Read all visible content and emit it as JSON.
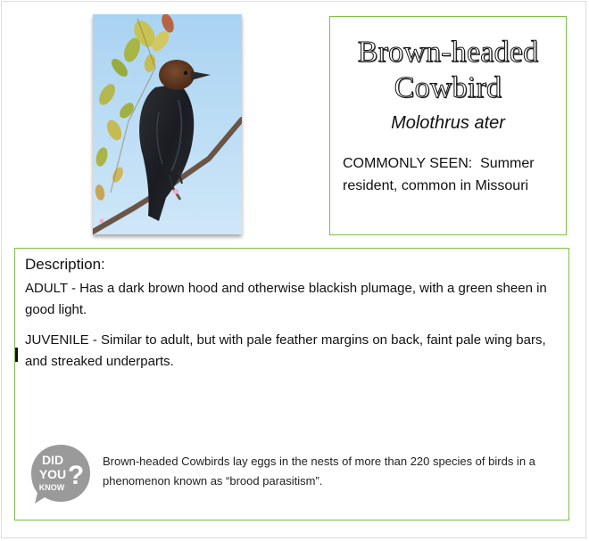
{
  "bird": {
    "common_name_line1": "Brown-headed",
    "common_name_line2": "Cowbird",
    "scientific_name": "Molothrus ater",
    "commonly_seen_label": "COMMONLY SEEN:",
    "commonly_seen_value": "Summer resident, common in Missouri"
  },
  "description": {
    "heading": "Description:",
    "adult": "ADULT - Has a dark brown hood and otherwise blackish plumage, with a green sheen in good light.",
    "juvenile": "JUVENILE - Similar to adult, but with pale feather margins on back, faint pale wing bars, and streaked underparts."
  },
  "did_you_know": {
    "icon_line1": "DID",
    "icon_line2": "YOU",
    "icon_line3": "KNOW",
    "icon_qmark": "?",
    "fact": "Brown-headed Cowbirds lay eggs in the nests of more than 220 species of birds in a phenomenon known as “brood parasitism”."
  },
  "colors": {
    "box_border": "#7dbf4a",
    "sky": "#bfe0f6",
    "icon_gray": "#9a9a9a"
  },
  "photo": {
    "subject": "bird-photo"
  }
}
